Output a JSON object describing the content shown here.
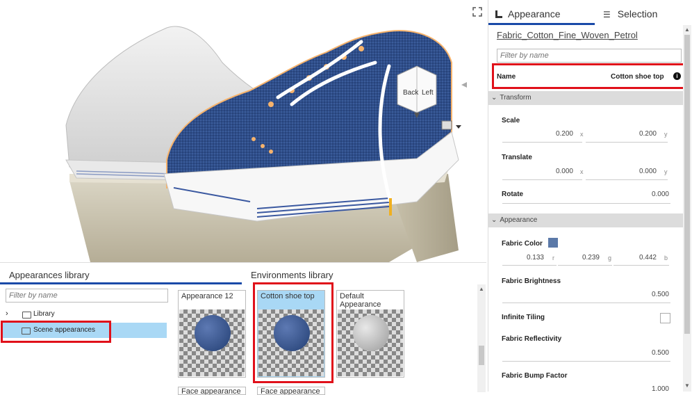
{
  "tabs": {
    "appearance": "Appearance",
    "selection": "Selection"
  },
  "material_link": "Fabric_Cotton_Fine_Woven_Petrol",
  "filter_placeholder": "Filter by name",
  "name_row": {
    "label": "Name",
    "value": "Cotton shoe top"
  },
  "transform": {
    "header": "Transform",
    "scale": {
      "label": "Scale",
      "x": "0.200",
      "y": "0.200"
    },
    "translate": {
      "label": "Translate",
      "x": "0.000",
      "y": "0.000"
    },
    "rotate": {
      "label": "Rotate",
      "value": "0.000"
    },
    "x_unit": "x",
    "y_unit": "y"
  },
  "appearance": {
    "header": "Appearance",
    "color": {
      "label": "Fabric Color",
      "r": "0.133",
      "g": "0.239",
      "b": "0.442",
      "swatch": "#5b79a8"
    },
    "brightness": {
      "label": "Fabric Brightness",
      "value": "0.500"
    },
    "tiling": {
      "label": "Infinite Tiling"
    },
    "reflectivity": {
      "label": "Fabric Reflectivity",
      "value": "0.500"
    },
    "bump": {
      "label": "Fabric Bump Factor",
      "value": "1.000"
    },
    "r_unit": "r",
    "g_unit": "g",
    "b_unit": "b"
  },
  "viewcube": {
    "back": "Back",
    "left": "Left"
  },
  "library": {
    "title": "Appearances library",
    "filter_placeholder": "Filter by name",
    "items": [
      "Library",
      "Scene appearances"
    ]
  },
  "environments": {
    "title": "Environments library"
  },
  "tiles": [
    "Appearance 12",
    "Cotton shoe top",
    "Default Appearance"
  ],
  "tiles_row2": [
    "Face appearance",
    "Face appearance"
  ],
  "colors": {
    "accent": "#1a4aa8",
    "highlight": "#e0101a",
    "selected": "#a9d8f5"
  }
}
